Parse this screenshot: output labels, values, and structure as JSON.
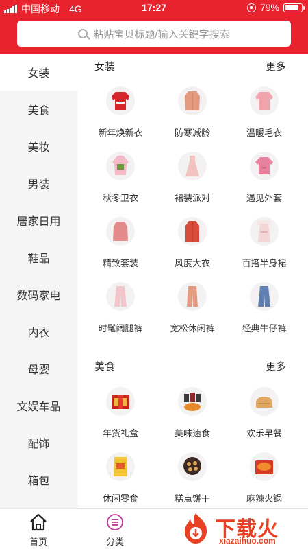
{
  "status_bar": {
    "carrier": "中国移动",
    "network": "4G",
    "time": "17:27",
    "battery_text": "79%",
    "battery_level": 0.79
  },
  "search": {
    "placeholder": "粘贴宝贝标题/输入关键字搜索"
  },
  "colors": {
    "brand": "#e8232e",
    "sidebar_bg": "#f5f5f5",
    "watermark": "#e84022"
  },
  "sidebar": {
    "items": [
      {
        "label": "女装",
        "active": true
      },
      {
        "label": "美食"
      },
      {
        "label": "美妆"
      },
      {
        "label": "男装"
      },
      {
        "label": "居家日用"
      },
      {
        "label": "鞋品"
      },
      {
        "label": "数码家电"
      },
      {
        "label": "内衣"
      },
      {
        "label": "母婴"
      },
      {
        "label": "文娱车品"
      },
      {
        "label": "配饰"
      },
      {
        "label": "箱包"
      }
    ]
  },
  "sections": [
    {
      "title": "女装",
      "more": "更多",
      "items": [
        {
          "label": "新年焕新衣",
          "icon": "red-sweater-icon"
        },
        {
          "label": "防寒减龄",
          "icon": "coat-icon"
        },
        {
          "label": "温暖毛衣",
          "icon": "pink-sweater-icon"
        },
        {
          "label": "秋冬卫衣",
          "icon": "hoodie-icon"
        },
        {
          "label": "裙装派对",
          "icon": "dress-icon"
        },
        {
          "label": "遇见外套",
          "icon": "jacket-icon"
        },
        {
          "label": "精致套装",
          "icon": "suit-icon"
        },
        {
          "label": "风度大衣",
          "icon": "overcoat-icon"
        },
        {
          "label": "百搭半身裙",
          "icon": "skirt-icon"
        },
        {
          "label": "时髦阔腿裤",
          "icon": "wide-pants-icon"
        },
        {
          "label": "宽松休闲裤",
          "icon": "casual-pants-icon"
        },
        {
          "label": "经典牛仔裤",
          "icon": "jeans-icon"
        }
      ]
    },
    {
      "title": "美食",
      "more": "更多",
      "items": [
        {
          "label": "年货礼盒",
          "icon": "gift-box-icon"
        },
        {
          "label": "美味速食",
          "icon": "snack-bags-icon"
        },
        {
          "label": "欢乐早餐",
          "icon": "bread-icon"
        },
        {
          "label": "休闲零食",
          "icon": "chips-icon"
        },
        {
          "label": "糕点饼干",
          "icon": "cookies-icon"
        },
        {
          "label": "麻辣火锅",
          "icon": "hotpot-icon"
        }
      ]
    }
  ],
  "tabbar": {
    "home": "首页",
    "category": "分类"
  },
  "watermark": {
    "text": "下载火",
    "url": "xiazaihuo.com"
  }
}
